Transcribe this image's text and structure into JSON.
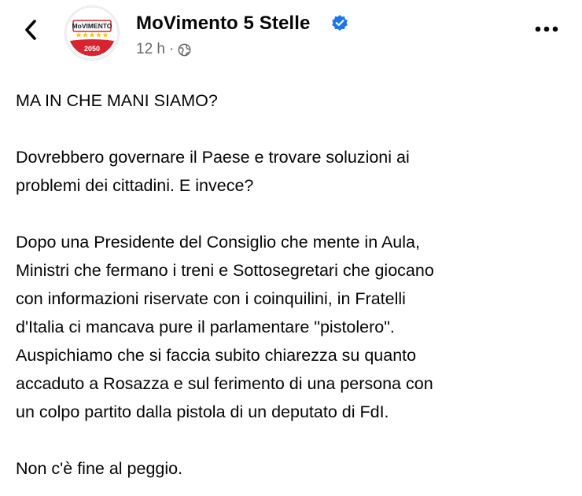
{
  "header": {
    "back_icon": "chevron-left-icon",
    "author_name": "MoVimento 5 Stelle",
    "verified_icon": "verified-badge-icon",
    "timestamp": "12 h",
    "separator": "·",
    "audience_icon": "globe-icon",
    "more_icon": "more-options-icon",
    "avatar": {
      "logo_text": "MoVIMENTO",
      "logo_year": "2050",
      "ring_color": "#d9232e",
      "star_color": "#f2c200"
    }
  },
  "post": {
    "paragraphs": [
      {
        "lines": [
          "MA IN CHE MANI SIAMO?"
        ]
      },
      {
        "lines": [
          "Dovrebbero governare il Paese e trovare soluzioni ai",
          "problemi dei cittadini. E invece?"
        ]
      },
      {
        "lines": [
          "Dopo una Presidente del Consiglio che mente in Aula,",
          "Ministri che fermano i treni e Sottosegretari che giocano",
          "con informazioni riservate con i coinquilini, in Fratelli",
          "d'Italia ci mancava pure il parlamentare \"pistolero\".",
          "Auspichiamo che si faccia subito chiarezza su quanto",
          "accaduto a Rosazza e sul ferimento di una persona con",
          "un colpo partito dalla pistola di un deputato di FdI."
        ]
      },
      {
        "lines": [
          "Non c'è fine al peggio."
        ]
      }
    ]
  },
  "colors": {
    "text": "#050505",
    "secondary_text": "#65676b",
    "verified_blue": "#1877f2"
  }
}
